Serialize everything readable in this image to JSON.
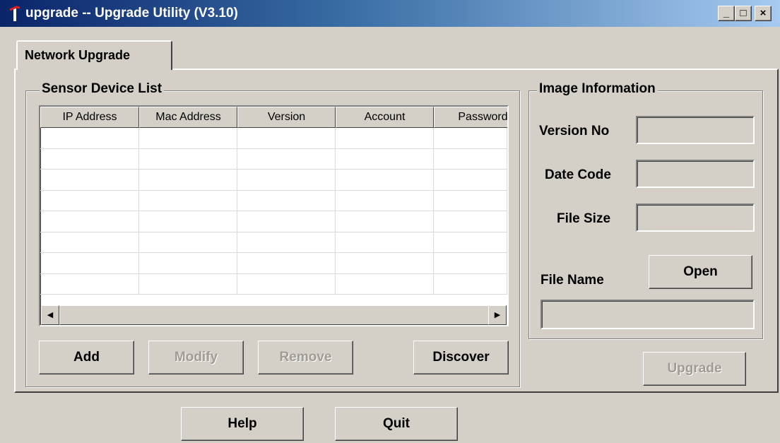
{
  "window": {
    "title": "upgrade -- Upgrade Utility (V3.10)",
    "controls": {
      "minimize": "_",
      "maximize": "□",
      "close": "×"
    }
  },
  "tabs": [
    {
      "label": "Network Upgrade",
      "active": true
    }
  ],
  "device_list": {
    "title": "Sensor Device List",
    "columns": [
      "IP Address",
      "Mac Address",
      "Version",
      "Account",
      "Password"
    ],
    "rows": [],
    "buttons": {
      "add": {
        "label": "Add",
        "enabled": true
      },
      "modify": {
        "label": "Modify",
        "enabled": false
      },
      "remove": {
        "label": "Remove",
        "enabled": false
      },
      "discover": {
        "label": "Discover",
        "enabled": true
      }
    }
  },
  "image_info": {
    "title": "Image Information",
    "version_no": {
      "label": "Version No",
      "value": ""
    },
    "date_code": {
      "label": "Date Code",
      "value": ""
    },
    "file_size": {
      "label": "File Size",
      "value": ""
    },
    "file_name": {
      "label": "File Name",
      "value": ""
    },
    "open_label": "Open"
  },
  "upgrade": {
    "label": "Upgrade",
    "enabled": false
  },
  "footer": {
    "help_label": "Help",
    "quit_label": "Quit"
  }
}
